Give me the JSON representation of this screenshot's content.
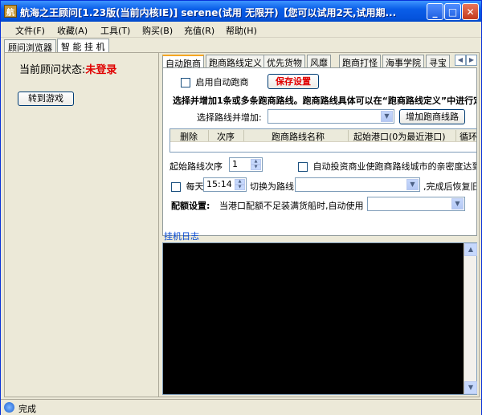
{
  "window": {
    "title": "航海之王顾问[1.23版(当前内核IE)] serene(试用 无限开)【您可以试用2天,试用期...",
    "app_icon": "航",
    "min_glyph": "_",
    "max_glyph": "□",
    "close_glyph": "✕"
  },
  "menu": [
    {
      "label": "文件(F)"
    },
    {
      "label": "收藏(A)"
    },
    {
      "label": "工具(T)"
    },
    {
      "label": "购买(B)"
    },
    {
      "label": "充值(R)"
    },
    {
      "label": "帮助(H)"
    }
  ],
  "outer_tabs": [
    {
      "label": "顾问浏览器"
    },
    {
      "label": "智 能 挂 机"
    }
  ],
  "left_panel": {
    "status_label": "当前顾问状态:",
    "status_value": "未登录",
    "goto_game_label": "转到游戏"
  },
  "inner_tabs": [
    {
      "label": "自动跑商"
    },
    {
      "label": "跑商路线定义"
    },
    {
      "label": "优先货物"
    },
    {
      "label": "风靡"
    },
    {
      "label": "跑商打怪"
    },
    {
      "label": "海事学院"
    },
    {
      "label": "寻宝"
    }
  ],
  "auto_trade": {
    "enable_label": "启用自动跑商",
    "save_label": "保存设置",
    "hint": "选择并增加1条或多条跑商路线。跑商路线具体可以在“跑商路线定义”中进行定义",
    "select_route_label": "选择路线并增加:",
    "add_route_label": "增加跑商线路",
    "grid_columns": [
      "删除",
      "次序",
      "跑商路线名称",
      "起始港口(0为最近港口)",
      "循环"
    ],
    "start_order_label": "起始路线次序",
    "start_order_value": "1",
    "auto_invest_label": "自动投资商业使跑商路线城市的亲密度达到",
    "daily_label": "每天",
    "daily_time": "15:14",
    "switch_route_label": "切换为路线",
    "restore_label": ",完成后恢复旧",
    "quota_label": "配额设置:",
    "quota_desc": "当港口配额不足装满货船时,自动使用"
  },
  "log": {
    "label": "挂机日志"
  },
  "statusbar": {
    "text": "完成"
  }
}
